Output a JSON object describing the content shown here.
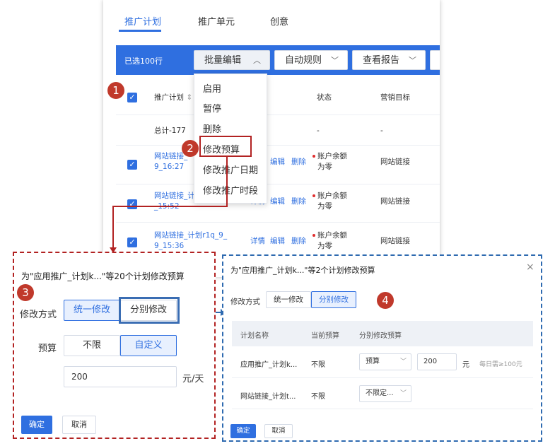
{
  "tabs": [
    "推广计划",
    "推广单元",
    "创意"
  ],
  "toolbar": {
    "selected": "已选100行",
    "batch_edit": "批量编辑",
    "auto_rules": "自动规则",
    "view_report": "查看报告"
  },
  "table": {
    "headers": [
      "推广计划",
      "状态",
      "营销目标"
    ],
    "sort_icon": "⇕",
    "total": {
      "name": "总计-177",
      "status": "-",
      "goal": "-"
    },
    "rows": [
      {
        "name1": "网站链接_",
        "name2": "9_16:27",
        "actions": [
          "编辑",
          "删除"
        ],
        "status1": "账户余额",
        "status2": "为零",
        "goal": "网站链接"
      },
      {
        "name1": "网站链接_计",
        "name2": "_15:52",
        "actions": [
          "详情",
          "编辑",
          "删除"
        ],
        "status1": "账户余额",
        "status2": "为零",
        "goal": "网站链接"
      },
      {
        "name1": "网站链接_计划r1q_9_",
        "name2": "9_15:36",
        "actions": [
          "详情",
          "编辑",
          "删除"
        ],
        "status1": "账户余额",
        "status2": "为零",
        "goal": "网站链接"
      }
    ]
  },
  "menu": [
    "启用",
    "暂停",
    "删除",
    "修改预算",
    "修改推广日期",
    "修改推广时段"
  ],
  "badges": [
    "1",
    "2",
    "3",
    "4"
  ],
  "dialog_unified": {
    "title": "为\"应用推广_计划k...\"等20个计划修改预算",
    "mode_label": "修改方式",
    "mode_options": [
      "统一修改",
      "分别修改"
    ],
    "budget_label": "预算",
    "budget_options": [
      "不限",
      "自定义"
    ],
    "budget_value": "200",
    "unit": "元/天",
    "ok": "确定",
    "cancel": "取消"
  },
  "dialog_separate": {
    "title": "为\"应用推广_计划k...\"等2个计划修改预算",
    "close": "×",
    "mode_label": "修改方式",
    "mode_options": [
      "统一修改",
      "分别修改"
    ],
    "headers": [
      "计划名称",
      "当前预算",
      "分别修改预算"
    ],
    "rows": [
      {
        "name": "应用推广_计划k...",
        "current": "不限",
        "select": "预算",
        "value": "200",
        "unit": "元",
        "hint": "每日需≥100元"
      },
      {
        "name": "网站链接_计划t...",
        "current": "不限",
        "select": "不限定..."
      }
    ],
    "ok": "确定",
    "cancel": "取消"
  },
  "colors": {
    "primary": "#2f6fe0",
    "badge": "#c0392b",
    "dashed_red": "#b22222",
    "dashed_blue": "#2e6ab0"
  }
}
